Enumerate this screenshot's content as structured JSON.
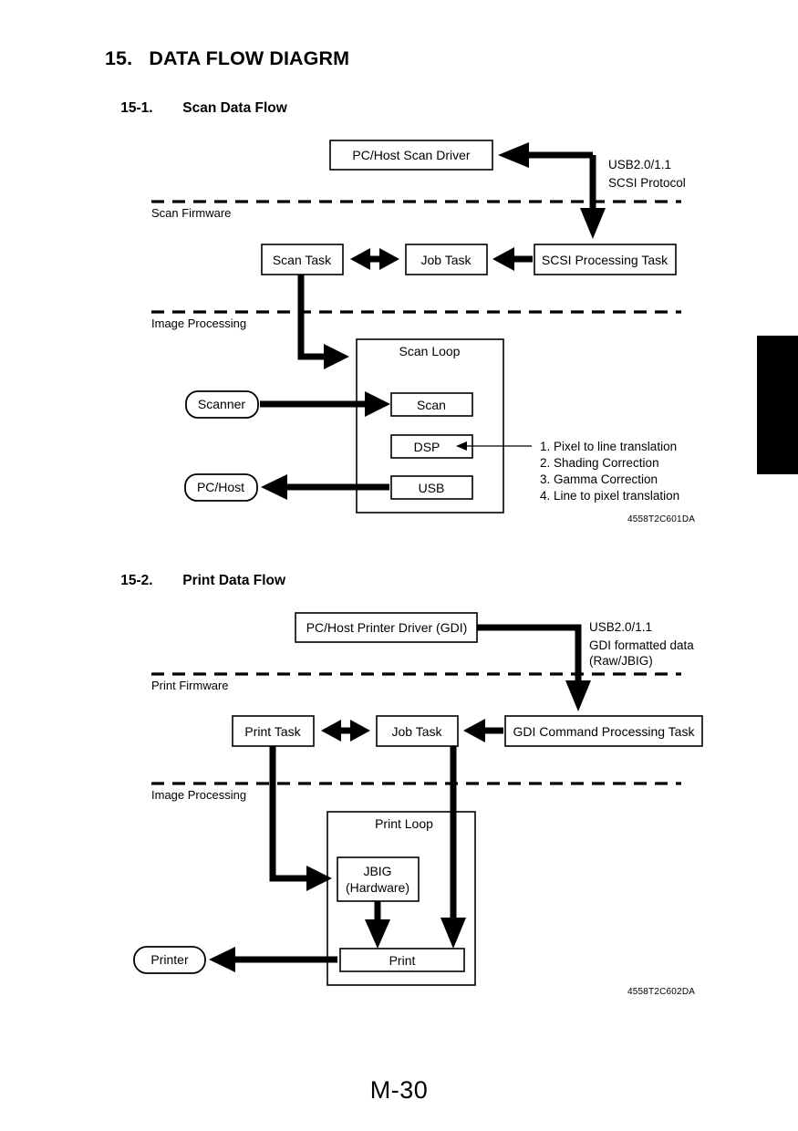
{
  "document": {
    "chapter_heading": "15.   DATA FLOW DIAGRM",
    "page_number": "M-30"
  },
  "sections": [
    {
      "number": "15-1.",
      "title": "Scan Data Flow",
      "figure_id": "4558T2C601DA",
      "zones": [
        {
          "label": "Scan Firmware"
        },
        {
          "label": "Image Processing"
        }
      ],
      "nodes": {
        "host_driver": "PC/Host Scan Driver",
        "scan_task": "Scan Task",
        "job_task": "Job Task",
        "scsi_task": "SCSI Processing Task",
        "loop_title": "Scan Loop",
        "scan": "Scan",
        "dsp": "DSP",
        "usb": "USB",
        "scanner": "Scanner",
        "pc_host": "PC/Host"
      },
      "link_labels": {
        "interface_line1": "USB2.0/1.1",
        "interface_line2": "SCSI Protocol"
      },
      "dsp_notes": [
        "1. Pixel to line translation",
        "2. Shading Correction",
        "3. Gamma Correction",
        "4. Line to pixel translation"
      ]
    },
    {
      "number": "15-2.",
      "title": "Print Data Flow",
      "figure_id": "4558T2C602DA",
      "zones": [
        {
          "label": "Print Firmware"
        },
        {
          "label": "Image Processing"
        }
      ],
      "nodes": {
        "host_driver": "PC/Host Printer Driver (GDI)",
        "print_task": "Print Task",
        "job_task": "Job Task",
        "gdi_task": "GDI Command Processing Task",
        "loop_title": "Print Loop",
        "jbig_line1": "JBIG",
        "jbig_line2": "(Hardware)",
        "print": "Print",
        "printer": "Printer"
      },
      "link_labels": {
        "interface_line1": "USB2.0/1.1",
        "interface_line2": "GDI formatted data",
        "interface_line3": "(Raw/JBIG)"
      }
    }
  ]
}
